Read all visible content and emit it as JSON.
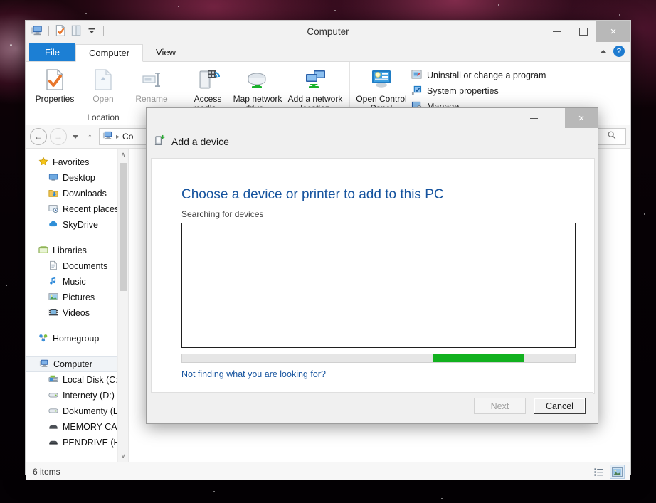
{
  "window": {
    "title": "Computer",
    "quick_access": [
      "computer-icon",
      "properties-icon",
      "open-icon",
      "customize-caret"
    ],
    "caption": {
      "minimize": "–",
      "maximize": "□",
      "close": "×"
    }
  },
  "ribbon": {
    "tabs": [
      {
        "label": "File",
        "state": "file"
      },
      {
        "label": "Computer",
        "state": "active"
      },
      {
        "label": "View",
        "state": "normal"
      }
    ],
    "collapse_icon": "chevron-up-icon",
    "help_icon": "help-icon",
    "help_glyph": "?",
    "groups": [
      {
        "label": "Location",
        "buttons": [
          {
            "label": "Properties",
            "icon": "properties-icon",
            "disabled": false,
            "split": false
          },
          {
            "label": "Open",
            "icon": "open-icon",
            "disabled": true,
            "split": false
          },
          {
            "label": "Rename",
            "icon": "rename-icon",
            "disabled": true,
            "split": false
          }
        ]
      },
      {
        "label": "",
        "buttons": [
          {
            "label": "Access media",
            "icon": "access-media-icon",
            "disabled": false,
            "split": true
          },
          {
            "label": "Map network drive",
            "icon": "map-network-drive-icon",
            "disabled": false,
            "split": true
          },
          {
            "label": "Add a network location",
            "icon": "add-network-location-icon",
            "disabled": false,
            "split": false
          }
        ]
      },
      {
        "label": "",
        "buttons": [
          {
            "label": "Open Control Panel",
            "icon": "control-panel-icon",
            "disabled": false,
            "split": false
          }
        ],
        "small_items": [
          {
            "label": "Uninstall or change a program",
            "icon": "uninstall-icon"
          },
          {
            "label": "System properties",
            "icon": "system-properties-icon"
          },
          {
            "label": "Manage",
            "icon": "manage-icon"
          }
        ]
      }
    ]
  },
  "addressbar": {
    "back_glyph": "←",
    "forward_glyph": "→",
    "up_glyph": "↑",
    "crumb_root": "Co",
    "crumb_sep": "▸",
    "search_icon": "search-icon"
  },
  "navpane": {
    "items": [
      {
        "label": "Favorites",
        "icon": "favorites-star-icon",
        "level": 0,
        "selected": false
      },
      {
        "label": "Desktop",
        "icon": "desktop-icon",
        "level": 1,
        "selected": false
      },
      {
        "label": "Downloads",
        "icon": "downloads-icon",
        "level": 1,
        "selected": false
      },
      {
        "label": "Recent places",
        "icon": "recent-places-icon",
        "level": 1,
        "selected": false
      },
      {
        "label": "SkyDrive",
        "icon": "skydrive-icon",
        "level": 1,
        "selected": false
      },
      {
        "label": "Libraries",
        "icon": "libraries-icon",
        "level": 0,
        "selected": false,
        "gap_before": true
      },
      {
        "label": "Documents",
        "icon": "documents-icon",
        "level": 1,
        "selected": false
      },
      {
        "label": "Music",
        "icon": "music-icon",
        "level": 1,
        "selected": false
      },
      {
        "label": "Pictures",
        "icon": "pictures-icon",
        "level": 1,
        "selected": false
      },
      {
        "label": "Videos",
        "icon": "videos-icon",
        "level": 1,
        "selected": false
      },
      {
        "label": "Homegroup",
        "icon": "homegroup-icon",
        "level": 0,
        "selected": false,
        "gap_before": true
      },
      {
        "label": "Computer",
        "icon": "computer-icon",
        "level": 0,
        "selected": true,
        "gap_before": true
      },
      {
        "label": "Local Disk (C:)",
        "icon": "local-disk-icon",
        "level": 1,
        "selected": false
      },
      {
        "label": "Internety (D:)",
        "icon": "drive-icon",
        "level": 1,
        "selected": false
      },
      {
        "label": "Dokumenty (E:)",
        "icon": "drive-icon",
        "level": 1,
        "selected": false
      },
      {
        "label": "MEMORY CARD",
        "icon": "removable-drive-icon",
        "level": 1,
        "selected": false
      },
      {
        "label": "PENDRIVE (H:)",
        "icon": "removable-drive-icon",
        "level": 1,
        "selected": false
      }
    ],
    "scroll_up_glyph": "∧",
    "scroll_down_glyph": "∨"
  },
  "statusbar": {
    "item_count": "6 items",
    "view_details_icon": "details-view-icon",
    "view_large_icons_icon": "large-icons-view-icon"
  },
  "dialog": {
    "title": "Add a device",
    "title_icon": "add-device-icon",
    "caption": {
      "minimize": "–",
      "maximize": "□",
      "close": "×"
    },
    "heading": "Choose a device or printer to add to this PC",
    "subtext": "Searching for devices",
    "device_list": [],
    "progress": {
      "indeterminate": true,
      "chunk_left_pct": 64,
      "chunk_width_pct": 23,
      "color": "#12b11f"
    },
    "help_link": "Not finding what you are looking for?",
    "buttons": [
      {
        "label": "Next",
        "disabled": true,
        "focused": false
      },
      {
        "label": "Cancel",
        "disabled": false,
        "focused": true
      }
    ]
  },
  "colors": {
    "accent_blue": "#1c7fd4",
    "link_blue": "#15539e",
    "progress_green": "#12b11f",
    "close_gray": "#b8b8b8"
  }
}
